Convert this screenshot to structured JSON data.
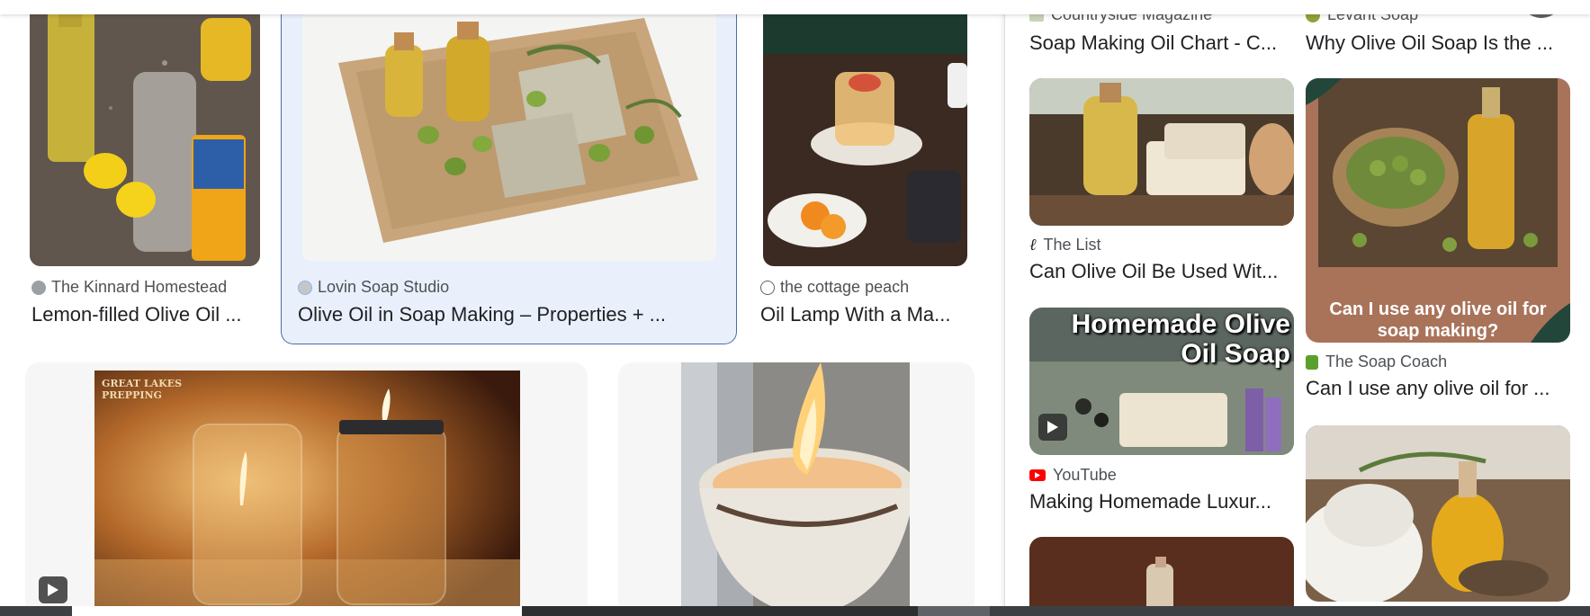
{
  "left_results": [
    {
      "source": "The Kinnard Homestead",
      "title": "Lemon-filled Olive Oil ..."
    },
    {
      "source": "Lovin Soap Studio",
      "title": "Olive Oil in Soap Making – Properties + ..."
    },
    {
      "source": "the cottage peach",
      "title": "Oil Lamp With a Ma..."
    }
  ],
  "big_card_watermark": "GREAT LAKES PREPPING",
  "panel": {
    "col1": [
      {
        "source": "Countryside Magazine",
        "title": "Soap Making Oil Chart - C..."
      },
      {
        "source": "The List",
        "title": "Can Olive Oil Be Used Wit..."
      },
      {
        "source": "YouTube",
        "title": "Making Homemade Luxur...",
        "image_text": "Homemade Olive Oil Soap"
      }
    ],
    "col2": [
      {
        "source": "Levant Soap",
        "title": "Why Olive Oil Soap Is the ..."
      },
      {
        "source": "The Soap Coach",
        "title": "Can I use any olive oil for ...",
        "image_text": "Can I use any olive oil for soap making?"
      }
    ]
  },
  "colors": {
    "selected_bg": "#e9f0fc",
    "selected_border": "#4a6fa5",
    "youtube_red": "#ff0000"
  }
}
